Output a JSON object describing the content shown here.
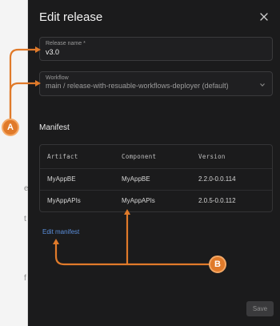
{
  "background": {
    "fragments": [
      "e",
      "t",
      "f"
    ]
  },
  "drawer": {
    "title": "Edit release",
    "close_icon": "close-icon"
  },
  "form": {
    "release_name": {
      "label": "Release name *",
      "value": "v3.0"
    },
    "workflow": {
      "label": "Workflow",
      "value": "main / release-with-resuable-workflows-deployer  (default)"
    }
  },
  "manifest": {
    "title": "Manifest",
    "columns": [
      "Artifact",
      "Component",
      "Version"
    ],
    "rows": [
      {
        "artifact": "MyAppBE",
        "component": "MyAppBE",
        "version": "2.2.0-0.0.114"
      },
      {
        "artifact": "MyAppAPIs",
        "component": "MyAppAPIs",
        "version": "2.0.5-0.0.112"
      }
    ],
    "edit_link": "Edit manifest"
  },
  "footer": {
    "save_label": "Save"
  },
  "annotations": {
    "badge_a": "A",
    "badge_b": "B",
    "color": "#e07a2a"
  }
}
